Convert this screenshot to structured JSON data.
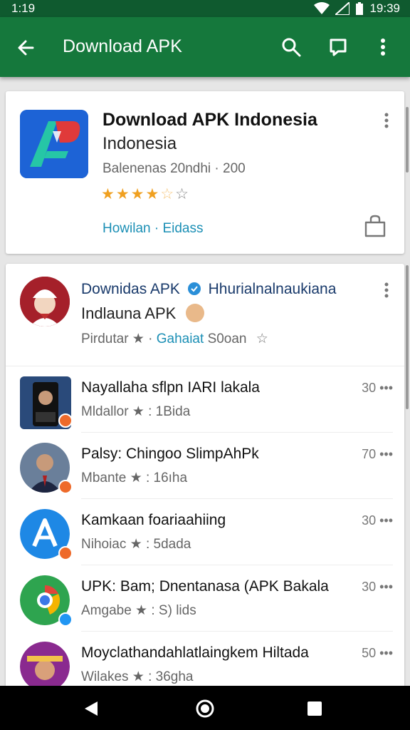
{
  "status": {
    "time": "1:19",
    "clock": "19:39"
  },
  "appbar": {
    "title": "Download APK"
  },
  "top_app": {
    "title": "Download APK Indonesia",
    "subtitle": "Indonesia",
    "meta": "Balenenas 20ndhi · 200",
    "rating": 3.5,
    "links": "Howilan · Eidass"
  },
  "featured": {
    "name": "Downidas APK",
    "name_rest": "Hhurialnalnaukiana",
    "line2": "Indlauna APK",
    "line3_a": "Pirdutar ★ ·",
    "line3_b": "Gahaiat",
    "line3_c": "S0oan"
  },
  "list": [
    {
      "name": "Nayallaha sflpn IARI lakala",
      "sub": "Mldallor ★ : 1Bida",
      "count": "30 •••"
    },
    {
      "name": "Palsy: Chingoo SlimpAhPk",
      "sub": "Mbante ★ : 16ıha",
      "count": "70 •••"
    },
    {
      "name": "Kamkaan foariaahiing",
      "sub": "Nihoiac ★ : 5dada",
      "count": "30 •••"
    },
    {
      "name": "UPK: Bam; Dnentanasa (APK Bakala",
      "sub": "Amgabe ★ : S) lids",
      "count": "30 •••"
    },
    {
      "name": "Moyclathandahlatlaingkem Hiltada",
      "sub": "Wilakes ★ : 36gha",
      "count": "50 •••"
    }
  ],
  "colors": {
    "status_bar": "#0f5a2f",
    "app_bar": "#15783c",
    "link": "#1b8fb5",
    "star": "#f0a020"
  },
  "icons": [
    "back-arrow-icon",
    "search-icon",
    "chat-icon",
    "more-vert-icon",
    "bag-icon",
    "nav-back-icon",
    "nav-home-icon",
    "nav-recents-icon"
  ]
}
